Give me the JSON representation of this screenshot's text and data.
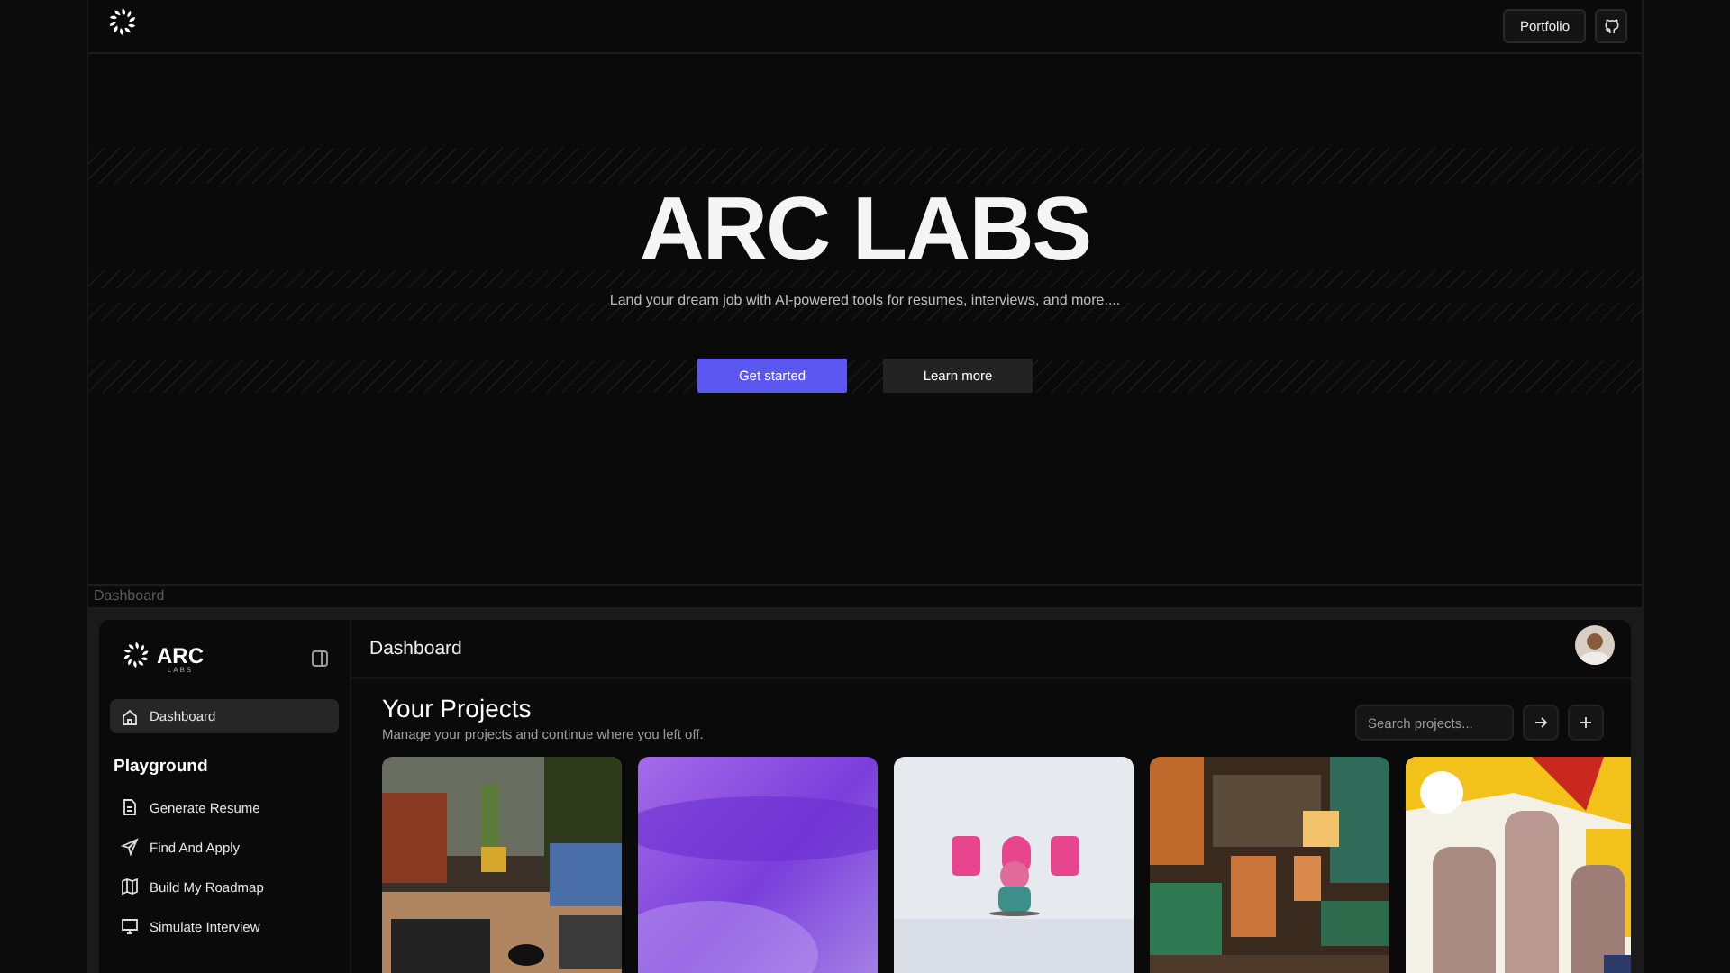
{
  "nav": {
    "buttons": [
      "Portfolio"
    ]
  },
  "hero": {
    "title": "ARC LABS",
    "subtitle": "Land your dream job with AI-powered tools for resumes, interviews, and more....",
    "buttons": [
      {
        "label": "Get started",
        "kind": "primary"
      },
      {
        "label": "Learn more",
        "kind": "secondary"
      }
    ]
  },
  "preview_label": "Dashboard",
  "app": {
    "logo": {
      "name": "ARC",
      "tagline": "LABS"
    },
    "sidebar": {
      "items": [
        {
          "label": "Dashboard",
          "selected": true
        }
      ],
      "section": "Playground",
      "playground": [
        {
          "label": "Generate Resume"
        },
        {
          "label": "Find And Apply"
        },
        {
          "label": "Build My Roadmap"
        },
        {
          "label": "Simulate Interview"
        }
      ]
    },
    "header": {
      "title": "Dashboard"
    },
    "projects": {
      "title": "Your Projects",
      "subtitle": "Manage your projects and continue where you left off.",
      "search": {
        "placeholder": "Search projects..."
      }
    }
  }
}
